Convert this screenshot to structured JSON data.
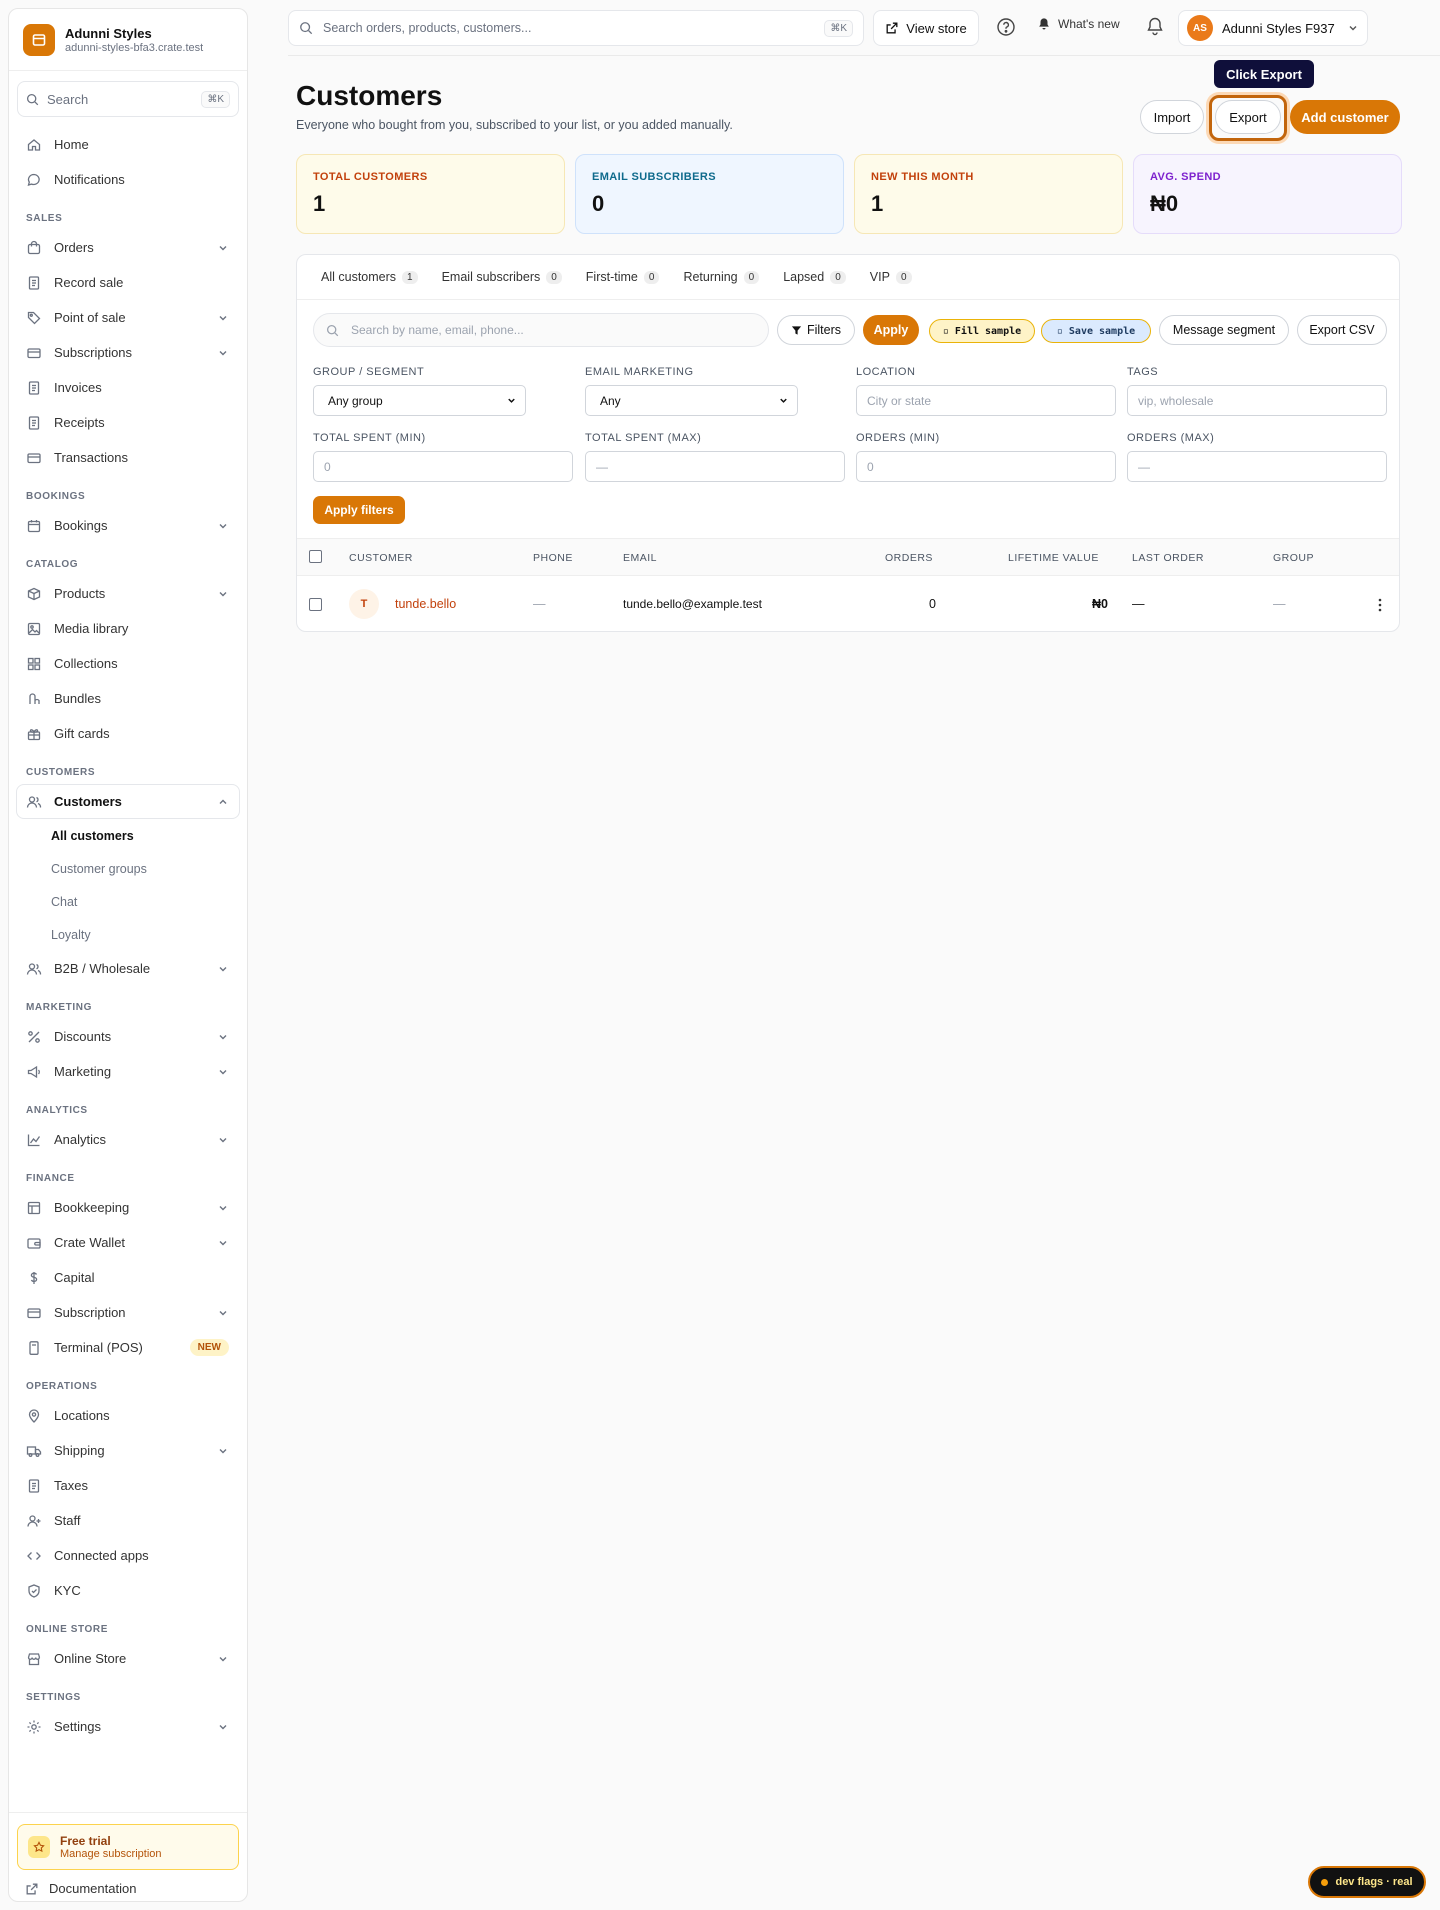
{
  "brand": {
    "name": "Adunni Styles",
    "domain": "adunni-styles-bfa3.crate.test"
  },
  "sidebar": {
    "search_label": "Search",
    "search_shortcut": "⌘K",
    "top_items": [
      {
        "label": "Home"
      },
      {
        "label": "Notifications"
      }
    ],
    "sections": {
      "sales": "SALES",
      "bookings": "BOOKINGS",
      "catalog": "CATALOG",
      "customers": "CUSTOMERS",
      "marketing": "MARKETING",
      "analytics": "ANALYTICS",
      "finance": "FINANCE",
      "operations": "OPERATIONS",
      "online_store": "ONLINE STORE",
      "settings": "SETTINGS"
    },
    "sales": [
      "Orders",
      "Record sale",
      "Point of sale",
      "Subscriptions",
      "Invoices",
      "Receipts",
      "Transactions"
    ],
    "bookings": [
      "Bookings"
    ],
    "catalog": [
      "Products",
      "Media library",
      "Collections",
      "Bundles",
      "Gift cards"
    ],
    "customers": {
      "label": "Customers",
      "sub": [
        "All customers",
        "Customer groups",
        "Chat",
        "Loyalty"
      ],
      "b2b": "B2B / Wholesale"
    },
    "marketing": [
      "Discounts",
      "Marketing"
    ],
    "analytics": [
      "Analytics"
    ],
    "finance": [
      "Bookkeeping",
      "Crate Wallet",
      "Capital",
      "Subscription",
      "Terminal (POS)"
    ],
    "finance_badge": "NEW",
    "operations": [
      "Locations",
      "Shipping",
      "Taxes",
      "Staff",
      "Connected apps",
      "KYC"
    ],
    "online_store": [
      "Online Store"
    ],
    "settings": [
      "Settings"
    ],
    "trial": {
      "title": "Free trial",
      "subtitle": "Manage subscription"
    },
    "documentation": "Documentation"
  },
  "topbar": {
    "search_placeholder": "Search orders, products, customers...",
    "search_shortcut": "⌘K",
    "view_store": "View store",
    "whats_new": "What's new",
    "account_initials": "AS",
    "account_name": "Adunni Styles F937"
  },
  "page": {
    "title": "Customers",
    "subtitle": "Everyone who bought from you, subscribed to your list, or you added manually.",
    "import": "Import",
    "export": "Export",
    "add_customer": "Add customer",
    "tooltip": "Click Export"
  },
  "stats": [
    {
      "label": "TOTAL CUSTOMERS",
      "value": "1"
    },
    {
      "label": "EMAIL SUBSCRIBERS",
      "value": "0"
    },
    {
      "label": "NEW THIS MONTH",
      "value": "1"
    },
    {
      "label": "AVG. SPEND",
      "value": "₦0"
    }
  ],
  "tabs": [
    {
      "label": "All customers",
      "count": "1"
    },
    {
      "label": "Email subscribers",
      "count": "0"
    },
    {
      "label": "First-time",
      "count": "0"
    },
    {
      "label": "Returning",
      "count": "0"
    },
    {
      "label": "Lapsed",
      "count": "0"
    },
    {
      "label": "VIP",
      "count": "0"
    }
  ],
  "filters": {
    "search_placeholder": "Search by name, email, phone...",
    "filters_btn": "Filters",
    "apply_btn": "Apply",
    "fill_sample": "▫ Fill sample",
    "save_sample": "▫ Save sample",
    "message_segment": "Message segment",
    "export_csv": "Export CSV",
    "group_label": "GROUP / SEGMENT",
    "group_value": "Any group",
    "email_label": "EMAIL MARKETING",
    "email_value": "Any",
    "location_label": "LOCATION",
    "location_placeholder": "City or state",
    "tags_label": "TAGS",
    "tags_placeholder": "vip, wholesale",
    "spent_min_label": "TOTAL SPENT (MIN)",
    "spent_min_placeholder": "0",
    "spent_max_label": "TOTAL SPENT (MAX)",
    "spent_max_placeholder": "—",
    "orders_min_label": "ORDERS (MIN)",
    "orders_min_placeholder": "0",
    "orders_max_label": "ORDERS (MAX)",
    "orders_max_placeholder": "—",
    "apply_filters": "Apply filters"
  },
  "table": {
    "headers": {
      "customer": "CUSTOMER",
      "phone": "PHONE",
      "email": "EMAIL",
      "orders": "ORDERS",
      "ltv": "LIFETIME VALUE",
      "last_order": "LAST ORDER",
      "group": "GROUP"
    },
    "rows": [
      {
        "initial": "T",
        "name": "tunde.bello",
        "phone": "—",
        "email": "tunde.bello@example.test",
        "orders": "0",
        "ltv": "₦0",
        "last_order": "—",
        "group": "—"
      }
    ]
  },
  "dev_flags": "dev flags · real",
  "colors": {
    "accent": "#d97706",
    "tooltip_bg": "#0f0f3a"
  }
}
